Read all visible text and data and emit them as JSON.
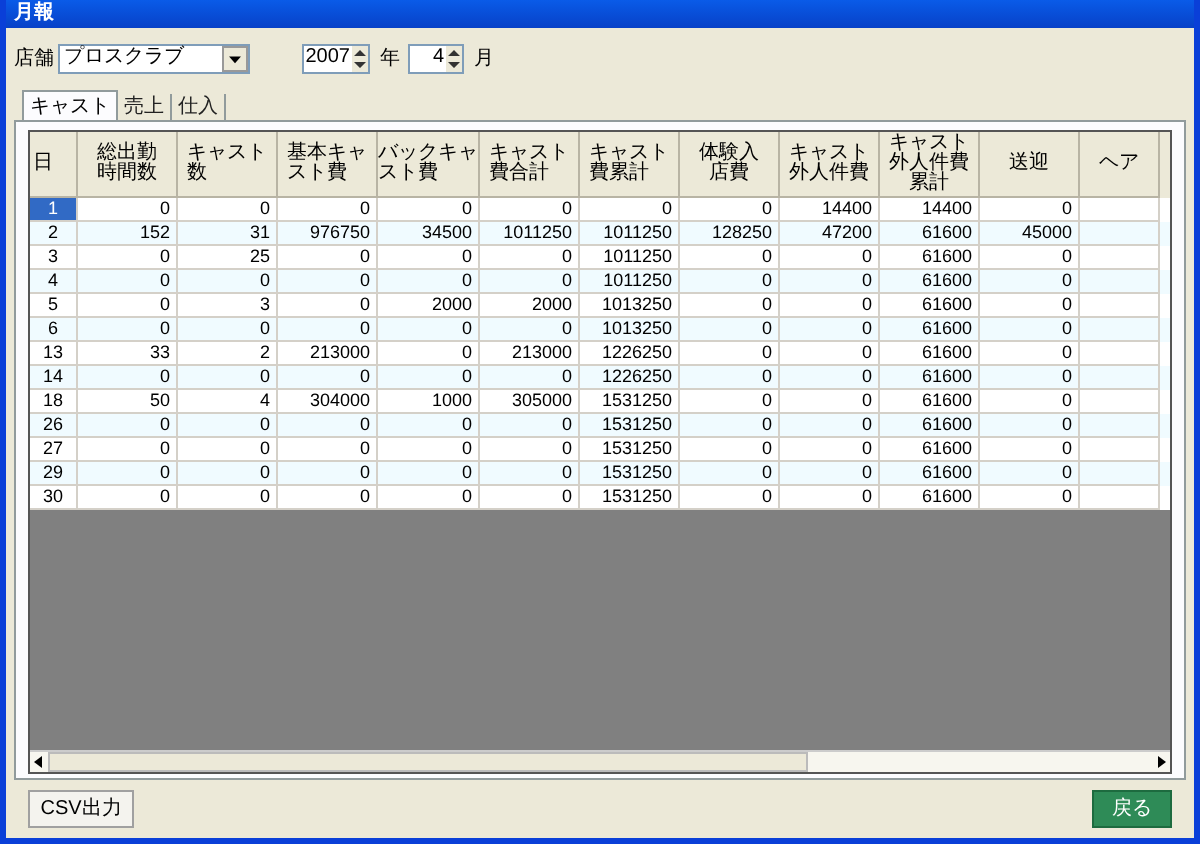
{
  "window": {
    "title": "月報"
  },
  "store": {
    "label": "店舗",
    "value": "プロスクラブ"
  },
  "year": {
    "value": "2007",
    "unit": "年"
  },
  "month": {
    "value": "4",
    "unit": "月"
  },
  "tabs": [
    {
      "label": "キャスト",
      "selected": true
    },
    {
      "label": "売上",
      "selected": false
    },
    {
      "label": "仕入",
      "selected": false
    }
  ],
  "table": {
    "columns": [
      "日",
      "総出勤時間数",
      "キャスト数",
      "基本キャスト費",
      "バックキャスト費",
      "キャスト費合計",
      "キャスト費累計",
      "体験入店費",
      "キャスト外人件費",
      "キャスト外人件費累計",
      "送迎",
      "ヘア"
    ],
    "rows": [
      {
        "day": "1",
        "selected": true,
        "values": [
          "0",
          "0",
          "0",
          "0",
          "0",
          "0",
          "0",
          "14400",
          "14400",
          "0"
        ]
      },
      {
        "day": "2",
        "selected": false,
        "values": [
          "152",
          "31",
          "976750",
          "34500",
          "1011250",
          "1011250",
          "128250",
          "47200",
          "61600",
          "45000"
        ]
      },
      {
        "day": "3",
        "selected": false,
        "values": [
          "0",
          "25",
          "0",
          "0",
          "0",
          "1011250",
          "0",
          "0",
          "61600",
          "0"
        ]
      },
      {
        "day": "4",
        "selected": false,
        "values": [
          "0",
          "0",
          "0",
          "0",
          "0",
          "1011250",
          "0",
          "0",
          "61600",
          "0"
        ]
      },
      {
        "day": "5",
        "selected": false,
        "values": [
          "0",
          "3",
          "0",
          "2000",
          "2000",
          "1013250",
          "0",
          "0",
          "61600",
          "0"
        ]
      },
      {
        "day": "6",
        "selected": false,
        "values": [
          "0",
          "0",
          "0",
          "0",
          "0",
          "1013250",
          "0",
          "0",
          "61600",
          "0"
        ]
      },
      {
        "day": "13",
        "selected": false,
        "values": [
          "33",
          "2",
          "213000",
          "0",
          "213000",
          "1226250",
          "0",
          "0",
          "61600",
          "0"
        ]
      },
      {
        "day": "14",
        "selected": false,
        "values": [
          "0",
          "0",
          "0",
          "0",
          "0",
          "1226250",
          "0",
          "0",
          "61600",
          "0"
        ]
      },
      {
        "day": "18",
        "selected": false,
        "values": [
          "50",
          "4",
          "304000",
          "1000",
          "305000",
          "1531250",
          "0",
          "0",
          "61600",
          "0"
        ]
      },
      {
        "day": "26",
        "selected": false,
        "values": [
          "0",
          "0",
          "0",
          "0",
          "0",
          "1531250",
          "0",
          "0",
          "61600",
          "0"
        ]
      },
      {
        "day": "27",
        "selected": false,
        "values": [
          "0",
          "0",
          "0",
          "0",
          "0",
          "1531250",
          "0",
          "0",
          "61600",
          "0"
        ]
      },
      {
        "day": "29",
        "selected": false,
        "values": [
          "0",
          "0",
          "0",
          "0",
          "0",
          "1531250",
          "0",
          "0",
          "61600",
          "0"
        ]
      },
      {
        "day": "30",
        "selected": false,
        "values": [
          "0",
          "0",
          "0",
          "0",
          "0",
          "1531250",
          "0",
          "0",
          "61600",
          "0"
        ]
      }
    ]
  },
  "buttons": [
    {
      "label": "CSV出力",
      "kind": "plain"
    },
    {
      "label": "戻る",
      "kind": "primary"
    }
  ]
}
